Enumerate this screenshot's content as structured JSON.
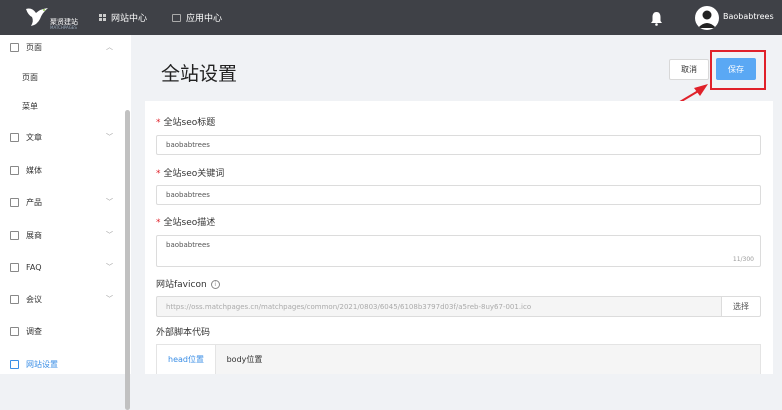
{
  "brand": {
    "name": "聚贤建站",
    "tagline": "MATCHPAGES"
  },
  "topnav": {
    "items": [
      {
        "label": "网站中心",
        "icon": "grid-icon"
      },
      {
        "label": "应用中心",
        "icon": "shopping-bag-icon"
      }
    ],
    "notification_icon": "bell-icon",
    "user": {
      "name": "Baobabtrees",
      "avatar_icon": "user-avatar-icon"
    }
  },
  "sidebar": {
    "items": [
      {
        "label": "页面",
        "icon": "page-icon",
        "expanded": true,
        "children": [
          "页面",
          "菜单"
        ]
      },
      {
        "label": "文章",
        "icon": "article-icon"
      },
      {
        "label": "媒体",
        "icon": "media-icon"
      },
      {
        "label": "产品",
        "icon": "product-icon"
      },
      {
        "label": "展商",
        "icon": "exhibitor-icon"
      },
      {
        "label": "FAQ",
        "icon": "faq-icon"
      },
      {
        "label": "会议",
        "icon": "meeting-icon"
      },
      {
        "label": "调查",
        "icon": "survey-icon"
      },
      {
        "label": "网站设置",
        "icon": "settings-icon",
        "active": true
      }
    ]
  },
  "page": {
    "title": "全站设置",
    "cancel_label": "取消",
    "save_label": "保存"
  },
  "form": {
    "seo_title": {
      "label": "全站seo标题",
      "value": "baobabtrees"
    },
    "seo_keywords": {
      "label": "全站seo关键词",
      "value": "baobabtrees"
    },
    "seo_description": {
      "label": "全站seo描述",
      "value": "baobabtrees",
      "counter": "11/300"
    },
    "favicon": {
      "label": "网站favicon",
      "value": "https://oss.matchpages.cn/matchpages/common/2021/0803/6045/6108b3797d03f/a5reb-8uy67-001.ico",
      "choose_label": "选择"
    },
    "external_code": {
      "label": "外部脚本代码",
      "tabs": [
        "head位置",
        "body位置"
      ]
    }
  },
  "colors": {
    "topbar": "#3f4147",
    "primary": "#5aa8f4",
    "highlight": "#e0212a"
  }
}
